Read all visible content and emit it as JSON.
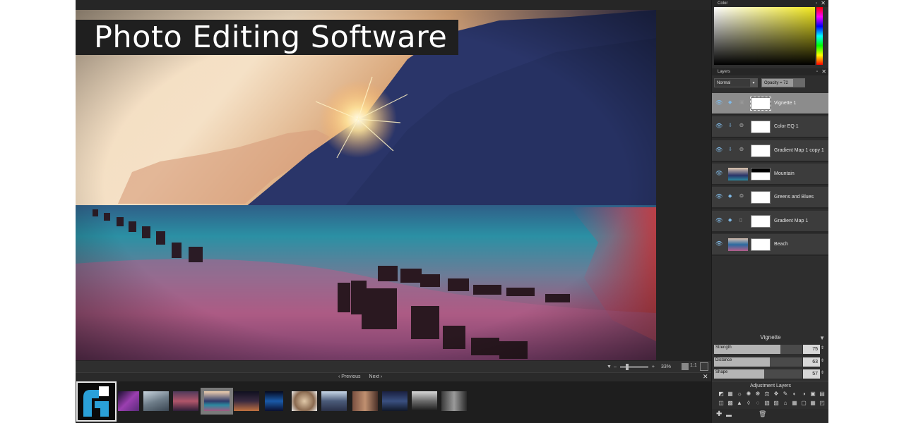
{
  "overlay": {
    "title": "Photo Editing Software"
  },
  "statusbar": {
    "zoom": "33%",
    "actual_size": "1:1",
    "minus": "–",
    "plus": "+"
  },
  "navbar": {
    "previous": "Previous",
    "next": "Next"
  },
  "panels": {
    "color": {
      "title": "Color",
      "pin": "▫",
      "close": "✕"
    },
    "layers": {
      "title": "Layers",
      "pin": "▫",
      "close": "✕",
      "blend_mode": "Normal",
      "opacity_label": "Opacity = 72",
      "opacity": 72,
      "items": [
        {
          "name": "Vignette  1",
          "selected": true
        },
        {
          "name": "Color EQ  1",
          "selected": false
        },
        {
          "name": "Gradient Map  1 copy 1",
          "selected": false
        },
        {
          "name": "Mountain",
          "selected": false
        },
        {
          "name": "Greens and Blues",
          "selected": false
        },
        {
          "name": "Gradient Map  1",
          "selected": false
        },
        {
          "name": "Beach",
          "selected": false
        }
      ]
    },
    "vignette": {
      "title": "Vignette",
      "sliders": [
        {
          "label": "Strength",
          "value": 75
        },
        {
          "label": "Distance",
          "value": 63
        },
        {
          "label": "Shape",
          "value": 57
        }
      ]
    },
    "adjustment_layers": {
      "title": "Adjustment Layers"
    }
  },
  "colors": {
    "accent": "#7fb9e6",
    "panel_bg": "#2e2e2e",
    "selected_layer": "#8c8c8c"
  }
}
